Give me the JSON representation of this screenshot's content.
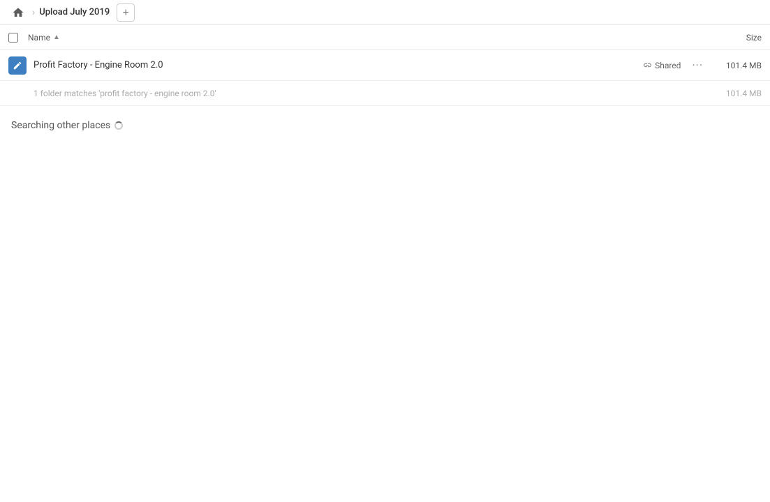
{
  "header": {
    "home_label": "Home",
    "breadcrumb_title": "Upload July 2019",
    "add_button_label": "+"
  },
  "columns": {
    "name_label": "Name",
    "size_label": "Size"
  },
  "file_row": {
    "name": "Profit Factory - Engine Room 2.0",
    "shared_label": "Shared",
    "more_label": "···",
    "size": "101.4 MB"
  },
  "sub_row": {
    "text": "1 folder matches 'profit factory - engine room 2.0'",
    "size": "101.4 MB"
  },
  "searching_section": {
    "label": "Searching other places"
  }
}
